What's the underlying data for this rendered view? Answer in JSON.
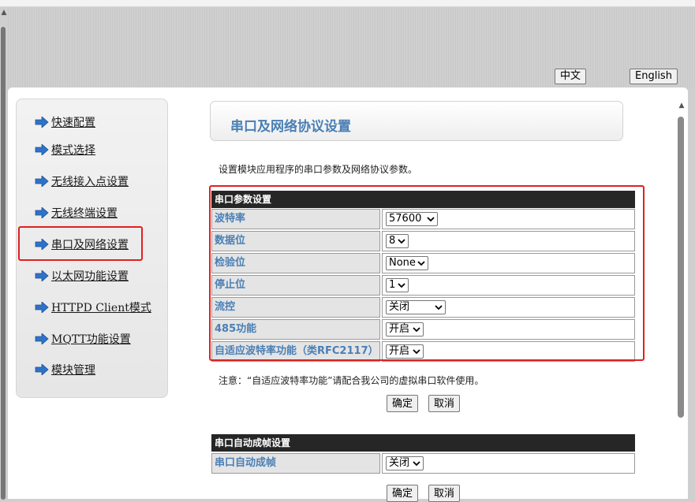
{
  "header": {
    "lang_chinese": "中文",
    "lang_english": "English"
  },
  "sidebar": {
    "items": [
      {
        "label": "快速配置"
      },
      {
        "label": "模式选择"
      },
      {
        "label": "无线接入点设置"
      },
      {
        "label": "无线终端设置"
      },
      {
        "label": "串口及网络设置",
        "selected": true
      },
      {
        "label": "以太网功能设置"
      },
      {
        "label": "HTTPD Client模式"
      },
      {
        "label": "MQTT功能设置"
      },
      {
        "label": "模块管理"
      }
    ],
    "arrow_color": "#2e73c9"
  },
  "main": {
    "title": "串口及网络协议设置",
    "description": "设置模块应用程序的串口参数及网络协议参数。",
    "serial_section": {
      "header": "串口参数设置",
      "rows": [
        {
          "label": "波特率",
          "value": "57600"
        },
        {
          "label": "数据位",
          "value": "8"
        },
        {
          "label": "检验位",
          "value": "None"
        },
        {
          "label": "停止位",
          "value": "1"
        },
        {
          "label": "流控",
          "value": "关闭"
        },
        {
          "label": "485功能",
          "value": "开启"
        },
        {
          "label": "自适应波特率功能（类RFC2117）",
          "value": "开启"
        }
      ]
    },
    "note": "注意：“自适应波特率功能”请配合我公司的虚拟串口软件使用。",
    "confirm_label": "确定",
    "cancel_label": "取消",
    "frame_section": {
      "header": "串口自动成帧设置",
      "rows": [
        {
          "label": "串口自动成帧",
          "value": "关闭"
        }
      ]
    }
  },
  "colors": {
    "accent_blue": "#4a7fb5",
    "highlight_red": "#e02020",
    "table_header": "#262626"
  }
}
